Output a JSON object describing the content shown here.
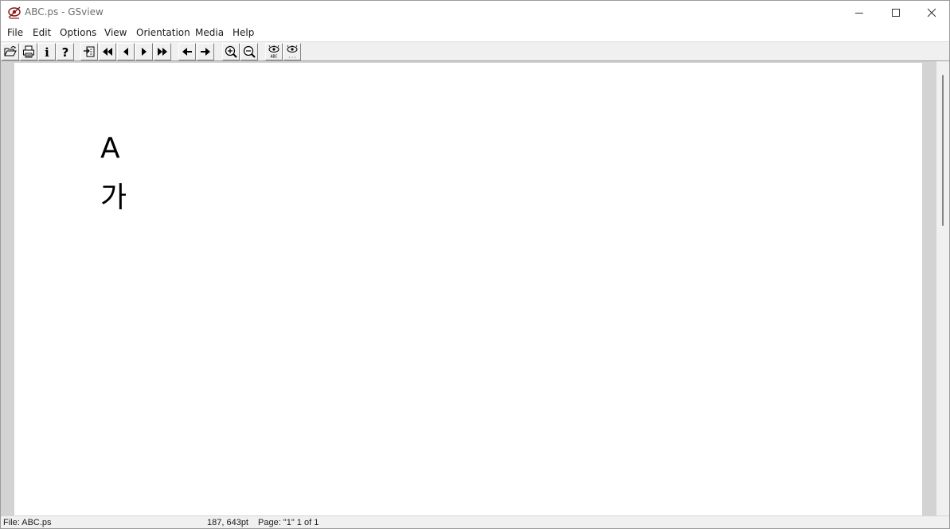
{
  "window": {
    "title": "ABC.ps - GSview",
    "controls": [
      "minimize-icon",
      "maximize-icon",
      "close-icon"
    ]
  },
  "menu": {
    "items": [
      "File",
      "Edit",
      "Options",
      "View",
      "Orientation",
      "Media",
      "Help"
    ]
  },
  "toolbar": {
    "buttons": [
      {
        "name": "open-button",
        "icon": "open-folder-icon"
      },
      {
        "name": "print-button",
        "icon": "printer-icon"
      },
      {
        "name": "info-button",
        "icon": "info-icon",
        "glyph": "i"
      },
      {
        "name": "help-button",
        "icon": "help-icon",
        "glyph": "?"
      },
      {
        "name": "goto-page-button",
        "icon": "goto-page-icon"
      },
      {
        "name": "first-page-button",
        "icon": "first-page-icon"
      },
      {
        "name": "prev-page-button",
        "icon": "prev-page-icon"
      },
      {
        "name": "next-page-button",
        "icon": "next-page-icon"
      },
      {
        "name": "last-page-button",
        "icon": "last-page-icon"
      },
      {
        "name": "back-button",
        "icon": "arrow-left-icon"
      },
      {
        "name": "forward-button",
        "icon": "arrow-right-icon"
      },
      {
        "name": "zoom-in-button",
        "icon": "zoom-in-icon"
      },
      {
        "name": "zoom-out-button",
        "icon": "zoom-out-icon"
      },
      {
        "name": "find-text-button",
        "icon": "find-text-icon",
        "glyph": "ABC"
      },
      {
        "name": "find-next-button",
        "icon": "find-next-icon",
        "glyph": "..."
      }
    ]
  },
  "document": {
    "line1": "A",
    "line2": "가"
  },
  "status": {
    "file": "File: ABC.ps",
    "coords": "187, 643pt",
    "page": "Page: \"1\"  1 of 1"
  }
}
